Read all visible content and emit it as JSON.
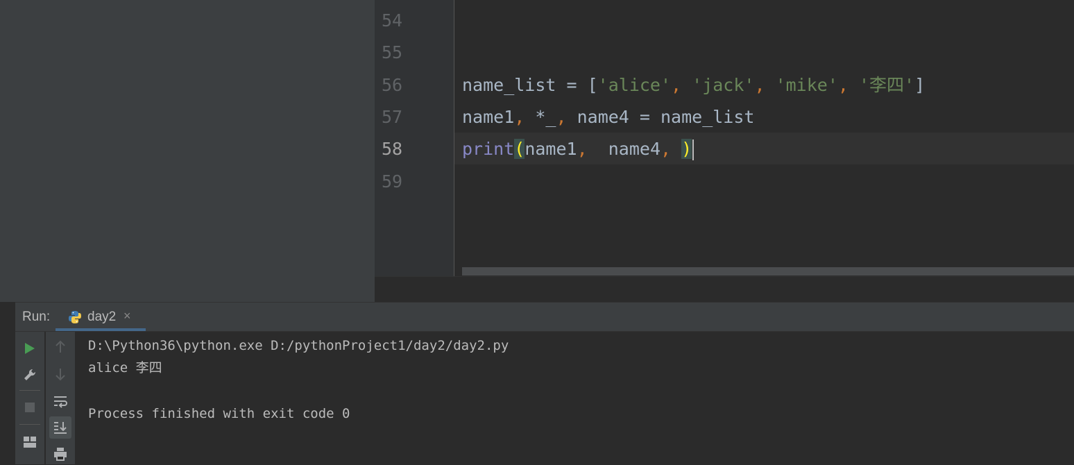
{
  "editor": {
    "lines": [
      {
        "num": "54",
        "tokens": []
      },
      {
        "num": "55",
        "tokens": []
      },
      {
        "num": "56",
        "tokens": [
          {
            "t": "name_list = [",
            "c": "plain"
          },
          {
            "t": "'alice'",
            "c": "str"
          },
          {
            "t": ", ",
            "c": "op"
          },
          {
            "t": "'jack'",
            "c": "str"
          },
          {
            "t": ", ",
            "c": "op"
          },
          {
            "t": "'mike'",
            "c": "str"
          },
          {
            "t": ", ",
            "c": "op"
          },
          {
            "t": "'李四'",
            "c": "str"
          },
          {
            "t": "]",
            "c": "plain"
          }
        ]
      },
      {
        "num": "57",
        "tokens": [
          {
            "t": "name1",
            "c": "plain"
          },
          {
            "t": ", ",
            "c": "op"
          },
          {
            "t": "*_",
            "c": "plain"
          },
          {
            "t": ", ",
            "c": "op"
          },
          {
            "t": "name4 = name_list",
            "c": "plain"
          }
        ]
      },
      {
        "num": "58",
        "tokens": [
          {
            "t": "print",
            "c": "fn"
          },
          {
            "t": "(",
            "c": "paren"
          },
          {
            "t": "name1",
            "c": "plain"
          },
          {
            "t": ",  ",
            "c": "op"
          },
          {
            "t": "name4",
            "c": "plain"
          },
          {
            "t": ", ",
            "c": "op"
          },
          {
            "t": ")",
            "c": "paren"
          }
        ]
      },
      {
        "num": "59",
        "tokens": []
      }
    ],
    "current_line": "58"
  },
  "run_panel": {
    "label": "Run:",
    "tab_name": "day2",
    "tab_close": "×",
    "console_lines": [
      "D:\\Python36\\python.exe D:/pythonProject1/day2/day2.py",
      "alice 李四",
      "",
      "Process finished with exit code 0"
    ]
  },
  "tool_icons": {
    "col1": [
      "run-icon",
      "wrench-icon",
      "stop-icon",
      "layout-icon"
    ],
    "col2": [
      "arrow-up-icon",
      "arrow-down-icon",
      "soft-wrap-icon",
      "scroll-to-end-icon",
      "print-icon"
    ]
  },
  "colors": {
    "string": "#6a8759",
    "operator": "#cc7832",
    "builtin": "#8888c6",
    "paren_match": "#ffef28",
    "run_green": "#499c54"
  }
}
